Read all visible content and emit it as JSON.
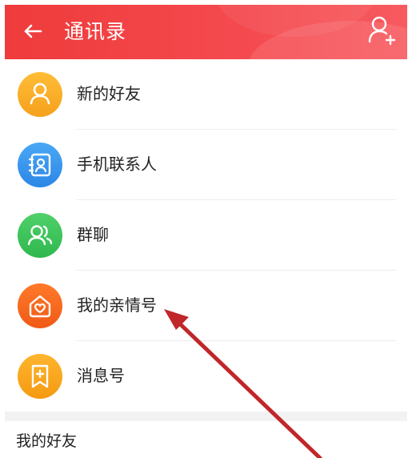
{
  "header": {
    "title": "通讯录",
    "back_icon": "back-arrow-icon",
    "add_icon": "add-user-icon",
    "color": "#ef3b3b"
  },
  "list": {
    "items": [
      {
        "label": "新的好友",
        "icon": "user-icon",
        "color": "#f5a11d"
      },
      {
        "label": "手机联系人",
        "icon": "contacts-book-icon",
        "color": "#2c87e6"
      },
      {
        "label": "群聊",
        "icon": "group-icon",
        "color": "#2fb84e"
      },
      {
        "label": "我的亲情号",
        "icon": "family-heart-icon",
        "color": "#f05a16"
      },
      {
        "label": "消息号",
        "icon": "bookmark-plus-icon",
        "color": "#f49a12"
      }
    ]
  },
  "section": {
    "title": "我的好友"
  },
  "annotation": {
    "color": "#c0262a"
  }
}
